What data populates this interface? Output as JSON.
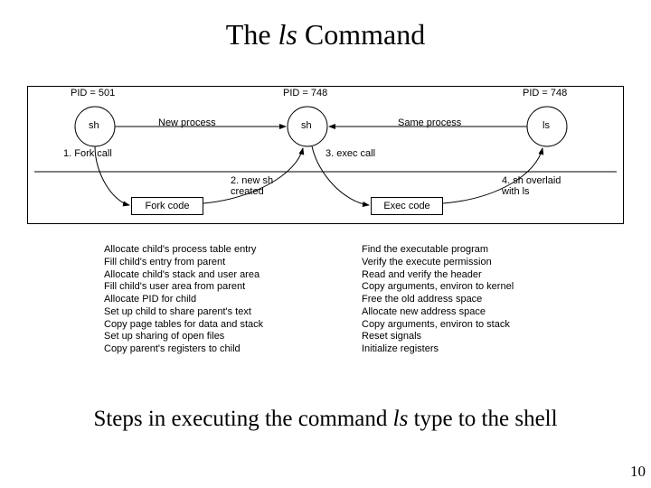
{
  "title_pre": "The ",
  "title_it": "ls",
  "title_post": " Command",
  "caption_pre": "Steps in executing the command ",
  "caption_it": "ls",
  "caption_post": " type to the shell",
  "page_number": "10",
  "pids": {
    "p1": "PID = 501",
    "p2": "PID = 748",
    "p3": "PID = 748"
  },
  "circles": {
    "c1": "sh",
    "c2": "sh",
    "c3": "ls"
  },
  "arrows": {
    "new_process": "New process",
    "same_process": "Same process",
    "fork_call": "1. Fork call",
    "new_sh_created": "2. new sh\ncreated",
    "exec_call": "3. exec call",
    "overlaid": "4. sh overlaid\nwith ls"
  },
  "boxes": {
    "fork": "Fork code",
    "exec": "Exec code"
  },
  "fork_steps": [
    "Allocate child's process table entry",
    "Fill child's entry from parent",
    "Allocate child's stack and user area",
    "Fill child's user area from parent",
    "Allocate PID for child",
    "Set up child to share parent's text",
    "Copy page tables for data and stack",
    "Set up sharing of open files",
    "Copy parent's registers to child"
  ],
  "exec_steps": [
    "Find the executable program",
    "Verify the execute permission",
    "Read and verify the header",
    "Copy arguments, environ to kernel",
    "Free the old address space",
    "Allocate new address space",
    "Copy arguments, environ to stack",
    "Reset signals",
    "Initialize registers"
  ]
}
